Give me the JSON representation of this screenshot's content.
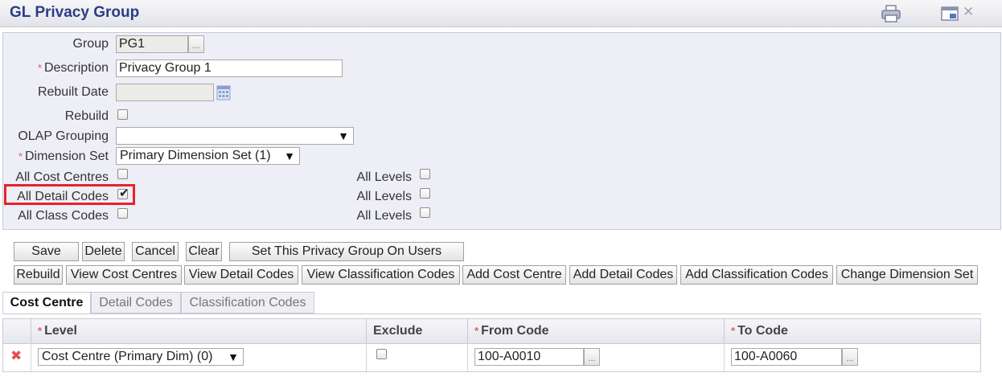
{
  "window": {
    "title": "GL Privacy Group",
    "close_glyph": "✕"
  },
  "icons": {
    "print": "printer-icon",
    "window": "window-icon",
    "close": "close-icon"
  },
  "form": {
    "group": {
      "label": "Group",
      "value": "PG1",
      "lookup": "..."
    },
    "description": {
      "label": "Description",
      "value": "Privacy Group 1",
      "required_mark": "*"
    },
    "rebuilt_date": {
      "label": "Rebuilt Date",
      "value": ""
    },
    "rebuild": {
      "label": "Rebuild",
      "checked": false
    },
    "olap_grouping": {
      "label": "OLAP Grouping",
      "value": ""
    },
    "dimension_set": {
      "label": "Dimension Set",
      "value": "Primary Dimension Set (1)",
      "required_mark": "*"
    },
    "all_cost_centres": {
      "label": "All Cost Centres",
      "checked": false
    },
    "all_detail_codes": {
      "label": "All Detail Codes",
      "checked": true
    },
    "all_class_codes": {
      "label": "All Class Codes",
      "checked": false
    },
    "all_levels_label": "All Levels",
    "arrow": "▼"
  },
  "toolbar1": {
    "save": "Save",
    "delete": "Delete",
    "cancel": "Cancel",
    "clear": "Clear",
    "set_on_users": "Set This Privacy Group On Users"
  },
  "toolbar2": {
    "rebuild": "Rebuild",
    "view_cost_centres": "View Cost Centres",
    "view_detail_codes": "View Detail Codes",
    "view_classification_codes": "View Classification Codes",
    "add_cost_centre": "Add Cost Centre",
    "add_detail_codes": "Add Detail Codes",
    "add_classification_codes": "Add Classification Codes",
    "change_dimension_set": "Change Dimension Set"
  },
  "tabs": [
    {
      "label": "Cost Centre",
      "active": true
    },
    {
      "label": "Detail Codes",
      "active": false
    },
    {
      "label": "Classification Codes",
      "active": false
    }
  ],
  "grid": {
    "headers": {
      "level": "Level",
      "exclude": "Exclude",
      "from_code": "From Code",
      "to_code": "To Code",
      "required_mark": "*"
    },
    "rows": [
      {
        "delete_glyph": "✖",
        "level": "Cost Centre (Primary Dim) (0)",
        "exclude": false,
        "from_code": "100-A0010",
        "to_code": "100-A0060",
        "lookup": "..."
      }
    ]
  }
}
